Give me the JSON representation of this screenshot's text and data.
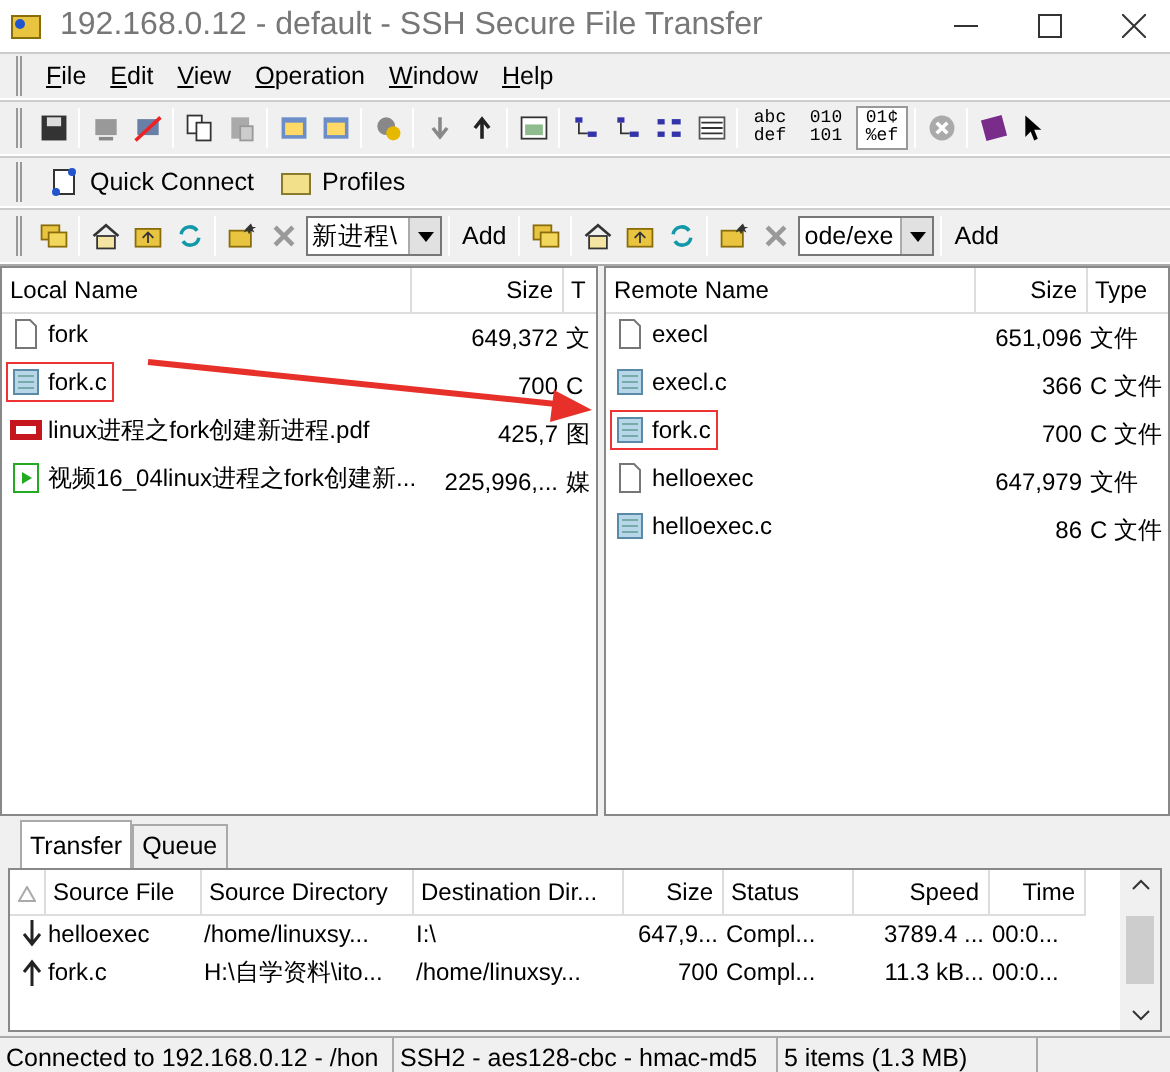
{
  "window": {
    "title": "192.168.0.12 - default - SSH Secure File Transfer"
  },
  "menu": [
    {
      "label": "File"
    },
    {
      "label": "Edit"
    },
    {
      "label": "View"
    },
    {
      "label": "Operation"
    },
    {
      "label": "Window"
    },
    {
      "label": "Help"
    }
  ],
  "transfer_modes": [
    {
      "label": "abc def",
      "selected": false
    },
    {
      "label": "010 101",
      "selected": false
    },
    {
      "label": "01¢ %ef",
      "selected": true
    }
  ],
  "quick_bar": [
    {
      "label": "Quick Connect"
    },
    {
      "label": "Profiles"
    }
  ],
  "local": {
    "path": "新进程\\",
    "add": "Add",
    "columns": [
      "Local Name",
      "Size",
      "T"
    ],
    "rows": [
      {
        "name": "fork",
        "size": "649,372",
        "type": "文",
        "kind": "file",
        "highlighted": false
      },
      {
        "name": "fork.c",
        "size": "700",
        "type": "C",
        "kind": "c",
        "highlighted": true
      },
      {
        "name": "linux进程之fork创建新进程.pdf",
        "size": "425,7",
        "type": "图",
        "kind": "pdf",
        "highlighted": false
      },
      {
        "name": "视频16_04linux进程之fork创建新...",
        "size": "225,996,...",
        "type": "媒",
        "kind": "video",
        "highlighted": false
      }
    ]
  },
  "remote": {
    "path": "ode/exe",
    "add": "Add",
    "columns": [
      "Remote Name",
      "Size",
      "Type"
    ],
    "rows": [
      {
        "name": "execl",
        "size": "651,096",
        "type": "文件",
        "kind": "file",
        "highlighted": false
      },
      {
        "name": "execl.c",
        "size": "366",
        "type": "C 文件",
        "kind": "c",
        "highlighted": false
      },
      {
        "name": "fork.c",
        "size": "700",
        "type": "C 文件",
        "kind": "c",
        "highlighted": true
      },
      {
        "name": "helloexec",
        "size": "647,979",
        "type": "文件",
        "kind": "file",
        "highlighted": false
      },
      {
        "name": "helloexec.c",
        "size": "86",
        "type": "C 文件",
        "kind": "c",
        "highlighted": false
      }
    ]
  },
  "tabs": [
    {
      "label": "Transfer",
      "selected": true
    },
    {
      "label": "Queue",
      "selected": false
    }
  ],
  "transfers": {
    "columns": [
      "Source File",
      "Source Directory",
      "Destination Dir...",
      "Size",
      "Status",
      "Speed",
      "Time"
    ],
    "rows": [
      {
        "kind": "download",
        "cells": [
          "helloexec",
          "/home/linuxsy...",
          "I:\\",
          "647,9...",
          "Compl...",
          "3789.4 ...",
          "00:0..."
        ]
      },
      {
        "kind": "upload",
        "cells": [
          "fork.c",
          "H:\\自学资料\\ito...",
          "/home/linuxsy...",
          "700",
          "Compl...",
          "11.3 kB...",
          "00:0..."
        ]
      }
    ]
  },
  "status_bar": [
    "Connected to 192.168.0.12 - /hon",
    "SSH2 - aes128-cbc - hmac-md5",
    "5 items (1.3 MB)"
  ]
}
